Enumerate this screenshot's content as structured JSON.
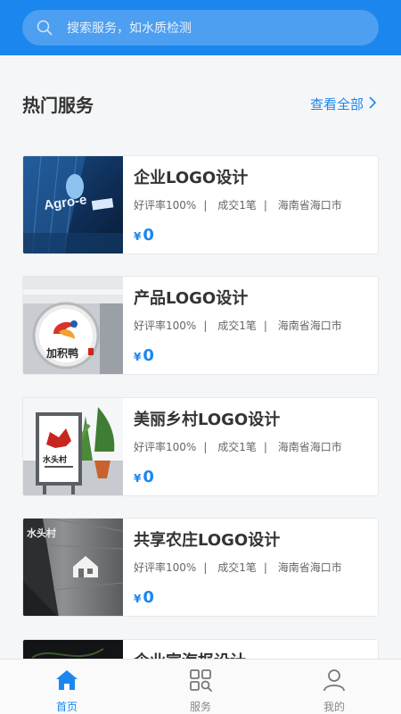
{
  "search": {
    "placeholder": "搜索服务，如水质检测"
  },
  "section": {
    "title": "热门服务",
    "more_label": "查看全部"
  },
  "services": [
    {
      "title": "企业LOGO设计",
      "rating": "好评率100%",
      "deals": "成交1笔",
      "location": "海南省海口市",
      "currency": "¥",
      "price": "0",
      "thumb": "building-logo-photo"
    },
    {
      "title": "产品LOGO设计",
      "rating": "好评率100%",
      "deals": "成交1笔",
      "location": "海南省海口市",
      "currency": "¥",
      "price": "0",
      "thumb": "round-sign-logo-photo"
    },
    {
      "title": "美丽乡村LOGO设计",
      "rating": "好评率100%",
      "deals": "成交1笔",
      "location": "海南省海口市",
      "currency": "¥",
      "price": "0",
      "thumb": "billboard-logo-photo"
    },
    {
      "title": "共享农庄LOGO设计",
      "rating": "好评率100%",
      "deals": "成交1笔",
      "location": "海南省海口市",
      "currency": "¥",
      "price": "0",
      "thumb": "wall-logo-photo"
    },
    {
      "title": "企业宣海报设计",
      "thumb": "dark-poster-photo"
    }
  ],
  "tabs": [
    {
      "label": "首页",
      "icon": "home-icon",
      "active": true
    },
    {
      "label": "服务",
      "icon": "grid-search-icon",
      "active": false
    },
    {
      "label": "我的",
      "icon": "user-icon",
      "active": false
    }
  ],
  "colors": {
    "accent": "#1b86ee",
    "background": "#f5f6f8"
  }
}
